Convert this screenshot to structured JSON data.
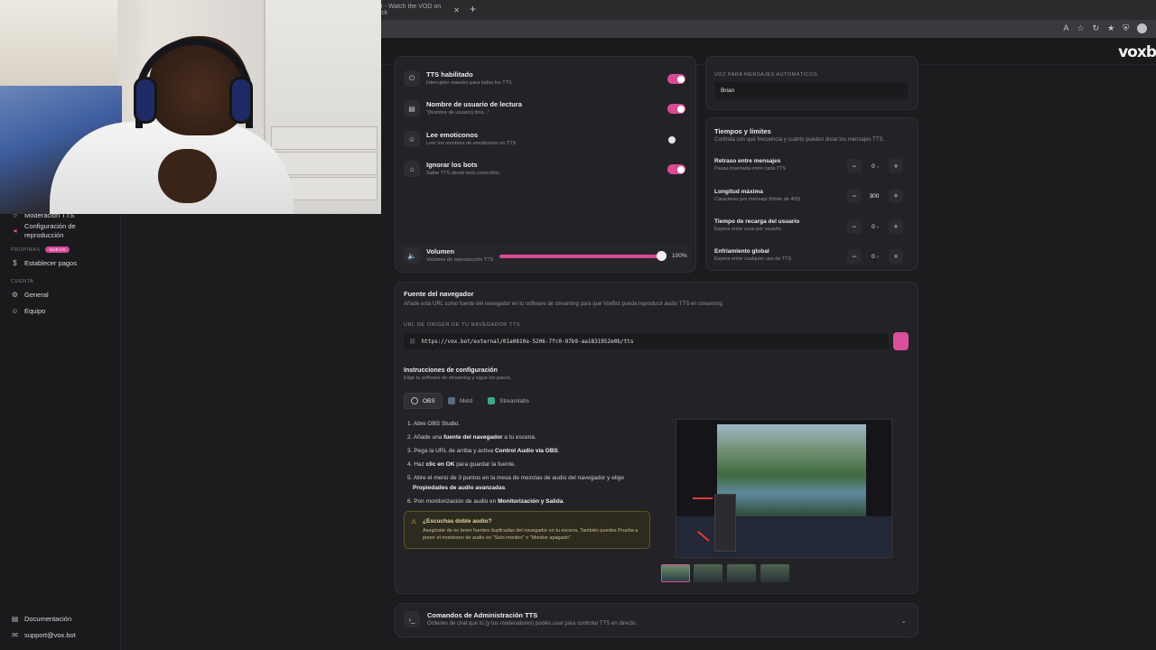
{
  "browser": {
    "tab_title": "ler - Watch the VOD on Kick",
    "new_tab": "+"
  },
  "app": {
    "logo": "voxb"
  },
  "sidebar": {
    "items": [
      {
        "label": "Moderación TTS"
      },
      {
        "label": "Configuración de\nreproducción"
      }
    ],
    "section_propinas": "PROPINAS",
    "badge_nuevo": "NUEVO",
    "establecer_pagos": "Establecer pagos",
    "section_cuenta": "CUENTA",
    "general": "General",
    "equipo": "Equipo",
    "documentacion": "Documentación",
    "support": "support@vox.bot"
  },
  "tts_settings": {
    "rows": [
      {
        "title": "TTS habilitado",
        "sub": "Interruptor maestro para todos los TTS",
        "on": true
      },
      {
        "title": "Nombre de usuario de lectura",
        "sub": "\"[Nombre de usuario] dice...\"",
        "on": true
      },
      {
        "title": "Lee emoticonos",
        "sub": "Leer los nombres de emoticonos en TTS",
        "on": false
      },
      {
        "title": "Ignorar los bots",
        "sub": "Saltar TTS desde bots conocidos",
        "on": true
      }
    ],
    "volume": {
      "title": "Volumen",
      "sub": "Volumen de reproducción TTS",
      "value_text": "100%",
      "value": 1.0
    }
  },
  "voice": {
    "label": "VOZ PARA MENSAJES AUTOMÁTICOS",
    "value": "Brian"
  },
  "limits": {
    "title": "Tiempos y límites",
    "sub": "Controla con qué frecuencia y cuánto pueden durar los mensajes TTS.",
    "rows": [
      {
        "title": "Retraso entre mensajes",
        "sub": "Pausa insertada entre cada TTS",
        "value": "0",
        "unit": "s"
      },
      {
        "title": "Longitud máxima",
        "sub": "Caracteres por mensaje (límite de 400)",
        "value": "300",
        "unit": ""
      },
      {
        "title": "Tiempo de recarga del usuario",
        "sub": "Espera entre usos por usuario.",
        "value": "0",
        "unit": "s"
      },
      {
        "title": "Enfriamiento global",
        "sub": "Espera entre cualquier uso de TTS",
        "value": "0",
        "unit": "s"
      }
    ],
    "minus": "−",
    "plus": "+"
  },
  "browser_source": {
    "title": "Fuente del navegador",
    "sub": "Añade esta URL como fuente del navegador en tu software de streaming para que VoxBot pueda reproducir audio TTS en streaming.",
    "url_label": "URL DE ORIGEN DE TU NAVEGADOR TTS",
    "url": "https://vox.bot/external/01a0810a-5206-7fc0-97b9-aa1831952e0b/tts",
    "instructions_title": "Instrucciones de configuración",
    "instructions_sub": "Elige tu software de streaming y sigue los pasos.",
    "tabs": [
      "OBS",
      "Meld",
      "Streamlabs"
    ],
    "steps": {
      "s1": "1. Abre OBS Studio.",
      "s2_a": "2. Añade una ",
      "s2_b": "fuente del navegador",
      "s2_c": " a tu escena.",
      "s3_a": "3. Pega la URL de arriba y activa ",
      "s3_b": "Control Audio vía OBS",
      "s3_c": ".",
      "s4_a": "4. Haz ",
      "s4_b": "clic en OK",
      "s4_c": " para guardar la fuente.",
      "s5_a": "5. Abre el menú de 3 puntos en la mesa de mezclas de audio del navegador y elige",
      "s5_b": "Propiedades de audio avanzadas",
      "s5_c": ".",
      "s6_a": "6. Pon monitorización de audio en ",
      "s6_b": "Monitorización y Salida",
      "s6_c": "."
    },
    "warning_title": "¿Escuchas doble audio?",
    "warning_text": "Asegúrate de no tener fuentes duplicadas del navegador en tu escena. También puedes Prueba a poner el monitoreo de audio en \"Solo monitor\" o \"Monitor apagado\"."
  },
  "admin_commands": {
    "title": "Comandos de Administración TTS",
    "sub": "Órdenes de chat que tú (y tus moderadores) podéis usar para controlar TTS en directo."
  },
  "colors": {
    "accent": "#d94a95",
    "bg": "#1c1c1f",
    "card": "#232327"
  }
}
